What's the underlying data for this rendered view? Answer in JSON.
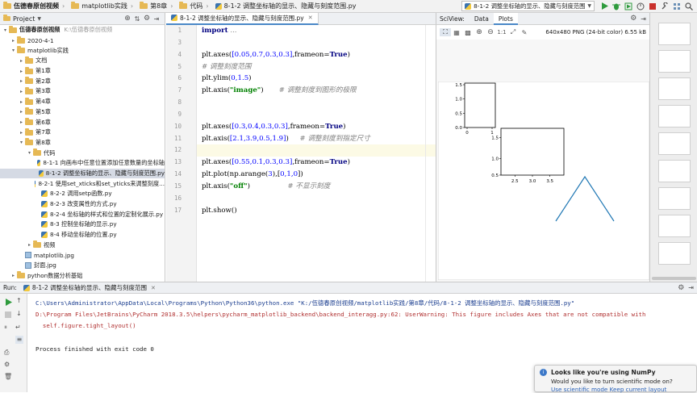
{
  "colors": {
    "accent": "#4a88c7",
    "run_green": "#2e9b3d",
    "stop_red": "#c9302c",
    "plot_line": "#1f77b4"
  },
  "navbar": {
    "crumbs": [
      "伍德春原创视频",
      "matplotlib实践",
      "第8章",
      "代码",
      "8-1-2 调整坐标轴的显示、隐藏与刻度范围.py"
    ],
    "run_config": "8-1-2 调整坐标轴的显示、隐藏与刻度范围"
  },
  "project": {
    "title": "Project",
    "tree": [
      {
        "label": "伍德春原创视频",
        "note": "K:\\伍德春原创视频",
        "depth": 0,
        "kind": "folder",
        "arrow": "▾"
      },
      {
        "label": "2020-4-1",
        "depth": 1,
        "kind": "folder",
        "arrow": "▸"
      },
      {
        "label": "matplotlib实践",
        "depth": 1,
        "kind": "folder",
        "arrow": "▾"
      },
      {
        "label": "文档",
        "depth": 2,
        "kind": "folder",
        "arrow": "▸"
      },
      {
        "label": "第1章",
        "depth": 2,
        "kind": "folder",
        "arrow": "▸"
      },
      {
        "label": "第2章",
        "depth": 2,
        "kind": "folder",
        "arrow": "▸"
      },
      {
        "label": "第3章",
        "depth": 2,
        "kind": "folder",
        "arrow": "▸"
      },
      {
        "label": "第4章",
        "depth": 2,
        "kind": "folder",
        "arrow": "▸"
      },
      {
        "label": "第5章",
        "depth": 2,
        "kind": "folder",
        "arrow": "▸"
      },
      {
        "label": "第6章",
        "depth": 2,
        "kind": "folder",
        "arrow": "▸"
      },
      {
        "label": "第7章",
        "depth": 2,
        "kind": "folder",
        "arrow": "▸"
      },
      {
        "label": "第8章",
        "depth": 2,
        "kind": "folder",
        "arrow": "▾"
      },
      {
        "label": "代码",
        "depth": 3,
        "kind": "folder",
        "arrow": "▾"
      },
      {
        "label": "8-1-1 向画布中任意位置添加任意数量的坐标轴",
        "depth": 4,
        "kind": "py",
        "arrow": ""
      },
      {
        "label": "8-1-2 调整坐标轴的显示、隐藏与刻度范围.py",
        "depth": 4,
        "kind": "py",
        "arrow": "",
        "selected": true
      },
      {
        "label": "8-2-1 使用set_xticks和set_yticks来调整刻度...",
        "depth": 4,
        "kind": "py",
        "arrow": ""
      },
      {
        "label": "8-2-2 调用setp函数.py",
        "depth": 4,
        "kind": "py",
        "arrow": ""
      },
      {
        "label": "8-2-3 改变属性的方式.py",
        "depth": 4,
        "kind": "py",
        "arrow": ""
      },
      {
        "label": "8-2-4 坐标轴的样式和位置的定制化展示.py",
        "depth": 4,
        "kind": "py",
        "arrow": ""
      },
      {
        "label": "8-3 控制坐标轴的显示.py",
        "depth": 4,
        "kind": "py",
        "arrow": ""
      },
      {
        "label": "8-4 移动坐标轴的位置.py",
        "depth": 4,
        "kind": "py",
        "arrow": ""
      },
      {
        "label": "视频",
        "depth": 3,
        "kind": "folder",
        "arrow": "▸"
      },
      {
        "label": "matplotlib.jpg",
        "depth": 2,
        "kind": "img",
        "arrow": ""
      },
      {
        "label": "封面.jpg",
        "depth": 2,
        "kind": "img",
        "arrow": ""
      },
      {
        "label": "python数据分析基础",
        "depth": 1,
        "kind": "folder",
        "arrow": "▸"
      }
    ]
  },
  "editor": {
    "tab": "8-1-2 调整坐标轴的显示、隐藏与刻度范围.py",
    "lines": [
      {
        "n": "1",
        "parts": [
          [
            "kw",
            "import"
          ],
          [
            "t",
            " "
          ],
          [
            "cm",
            "..."
          ]
        ]
      },
      {
        "n": "3",
        "parts": []
      },
      {
        "n": "4",
        "parts": [
          [
            "t",
            "plt.axes("
          ],
          [
            "num",
            "[0.05,0.7,0.3,0.3]"
          ],
          [
            "t",
            ",frameon="
          ],
          [
            "kw",
            "True"
          ],
          [
            "t",
            ")"
          ]
        ]
      },
      {
        "n": "5",
        "parts": [
          [
            "cm",
            "# 调整刻度范围"
          ]
        ]
      },
      {
        "n": "6",
        "parts": [
          [
            "t",
            "plt.ylim("
          ],
          [
            "num",
            "0,1.5"
          ],
          [
            "t",
            ")"
          ]
        ]
      },
      {
        "n": "7",
        "parts": [
          [
            "t",
            "plt.axis("
          ],
          [
            "str",
            "\"image\""
          ],
          [
            "t",
            ")       "
          ],
          [
            "cm",
            "# 调整刻度到图形的极限"
          ]
        ]
      },
      {
        "n": "8",
        "parts": []
      },
      {
        "n": "9",
        "parts": []
      },
      {
        "n": "10",
        "parts": [
          [
            "t",
            "plt.axes("
          ],
          [
            "num",
            "[0.3,0.4,0.3,0.3]"
          ],
          [
            "t",
            ",frameon="
          ],
          [
            "kw",
            "True"
          ],
          [
            "t",
            ")"
          ]
        ]
      },
      {
        "n": "11",
        "parts": [
          [
            "t",
            "plt.axis("
          ],
          [
            "num",
            "[2.1,3.9,0.5,1.9]"
          ],
          [
            "t",
            ")     "
          ],
          [
            "cm",
            "# 调整刻度到指定尺寸"
          ]
        ]
      },
      {
        "n": "12",
        "parts": [],
        "hl": true
      },
      {
        "n": "13",
        "parts": [
          [
            "t",
            "plt.axes("
          ],
          [
            "num",
            "[0.55,0.1,0.3,0.3]"
          ],
          [
            "t",
            ",frameon="
          ],
          [
            "kw",
            "True"
          ],
          [
            "t",
            ")"
          ]
        ]
      },
      {
        "n": "14",
        "parts": [
          [
            "t",
            "plt.plot(np.arange("
          ],
          [
            "num",
            "3"
          ],
          [
            "t",
            "),["
          ],
          [
            "num",
            "0,1,0"
          ],
          [
            "t",
            "])"
          ]
        ]
      },
      {
        "n": "15",
        "parts": [
          [
            "t",
            "plt.axis("
          ],
          [
            "str",
            "\"off\""
          ],
          [
            "t",
            ")                 "
          ],
          [
            "cm",
            "# 不显示刻度"
          ]
        ]
      },
      {
        "n": "16",
        "parts": []
      },
      {
        "n": "17",
        "parts": [
          [
            "t",
            "plt.show()"
          ]
        ]
      }
    ]
  },
  "sciview": {
    "label": "SciView:",
    "tabs": [
      "Data",
      "Plots"
    ],
    "active_tab": "Plots",
    "image_info": "640x480 PNG (24-bit color) 6.55 kB",
    "zoom_text": "1:1",
    "axes1": {
      "yticks": [
        "1.5",
        "1.0",
        "0.5",
        "0.0"
      ],
      "xticks": [
        "0",
        "1"
      ]
    },
    "axes2": {
      "yticks": [
        "1.5",
        "1.0",
        "0.5"
      ],
      "xticks": [
        "2.5",
        "3.0",
        "3.5"
      ]
    },
    "line_data": {
      "x": [
        0,
        1,
        2
      ],
      "y": [
        0,
        1,
        0
      ]
    }
  },
  "run": {
    "label": "Run:",
    "tab": "8-1-2 调整坐标轴的显示、隐藏与刻度范围",
    "lines": [
      {
        "text": "C:\\Users\\Administrator\\AppData\\Local\\Programs\\Python\\Python36\\python.exe \"K:/伍德春原创视频/matplotlib实践/第8章/代码/8-1-2 调整坐标轴的显示、隐藏与刻度范围.py\"",
        "color": "#1a3d8f"
      },
      {
        "text": "D:\\Program Files\\JetBrains\\PyCharm 2018.3.5\\helpers\\pycharm_matplotlib_backend\\backend_interagg.py:62: UserWarning: This figure includes Axes that are not compatible with",
        "color": "#b03030"
      },
      {
        "text": "  self.figure.tight_layout()",
        "color": "#b03030"
      },
      {
        "text": "",
        "color": "#222"
      },
      {
        "text": "Process finished with exit code 0",
        "color": "#222"
      }
    ]
  },
  "balloon": {
    "title": "Looks like you're using NumPy",
    "body": "Would you like to turn scientific mode on?",
    "links": "Use scientific mode   Keep current layout"
  }
}
